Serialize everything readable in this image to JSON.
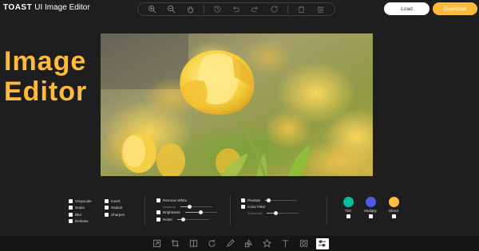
{
  "header": {
    "logo_mark": "TOAST",
    "logo_text": "UI Image Editor",
    "load_label": "Load",
    "download_label": "Download"
  },
  "top_menu": {
    "icons": [
      "zoom-in-icon",
      "zoom-out-icon",
      "hand-icon",
      "history-icon",
      "undo-icon",
      "redo-icon",
      "reset-icon",
      "delete-icon",
      "delete-all-icon"
    ]
  },
  "side_title": {
    "line1": "Image",
    "line2": "Editor"
  },
  "filters": {
    "col1": [
      "Grayscale",
      "Sepia",
      "Blur",
      "Emboss"
    ],
    "col2": [
      "Invert",
      "Sepia2",
      "Sharpen"
    ],
    "remove_white": "Remove White",
    "distance": "Distance",
    "brightness": "Brightness",
    "noise": "Noise",
    "pixelate": "Pixelate",
    "color_filter": "Color Filter",
    "threshold": "Threshold",
    "distance_level": 0.3,
    "brightness_level": 0.5,
    "noise_level": 0.2,
    "pixelate_level": 0.1,
    "threshold_level": 0.3
  },
  "color_filters": [
    {
      "label": "Tint",
      "color": "#03bd9e"
    },
    {
      "label": "Multiply",
      "color": "#515ce6"
    },
    {
      "label": "Blend",
      "color": "#ffbb3b"
    }
  ],
  "bottom_menu": {
    "icons": [
      "resize-icon",
      "crop-icon",
      "flip-icon",
      "rotate-icon",
      "draw-icon",
      "shape-icon",
      "icon-icon",
      "text-icon",
      "mask-icon",
      "filter-icon"
    ],
    "active": "filter-icon"
  },
  "colors": {
    "accent": "#fdba3b",
    "background": "#1e1e1e"
  }
}
